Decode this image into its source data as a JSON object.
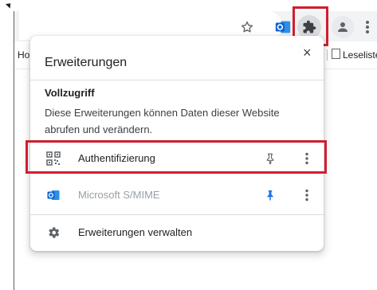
{
  "browser": {
    "bookmarks_bar": {
      "left_item_label": "Ho",
      "right_item_label": "Leseliste"
    },
    "toolbar_icons": [
      "star-icon",
      "outlook-icon",
      "puzzle-icon",
      "profile-icon",
      "menu-icon"
    ]
  },
  "extensions_popup": {
    "title": "Erweiterungen",
    "close_label": "×",
    "section_title": "Vollzugriff",
    "section_description": "Diese Erweiterungen können Daten dieser Website abrufen und verändern.",
    "extensions": [
      {
        "name": "Authentifizierung",
        "pinned": false,
        "enabled": true,
        "icon": "qr-code-icon"
      },
      {
        "name": "Microsoft S/MIME",
        "pinned": true,
        "enabled": false,
        "icon": "outlook-icon"
      }
    ],
    "manage_label": "Erweiterungen verwalten"
  },
  "colors": {
    "highlight_red": "#cf1f2f",
    "pin_active": "#1a73e8",
    "outlook_blue": "#0a64d6",
    "disabled_text": "#9aa0a6"
  }
}
